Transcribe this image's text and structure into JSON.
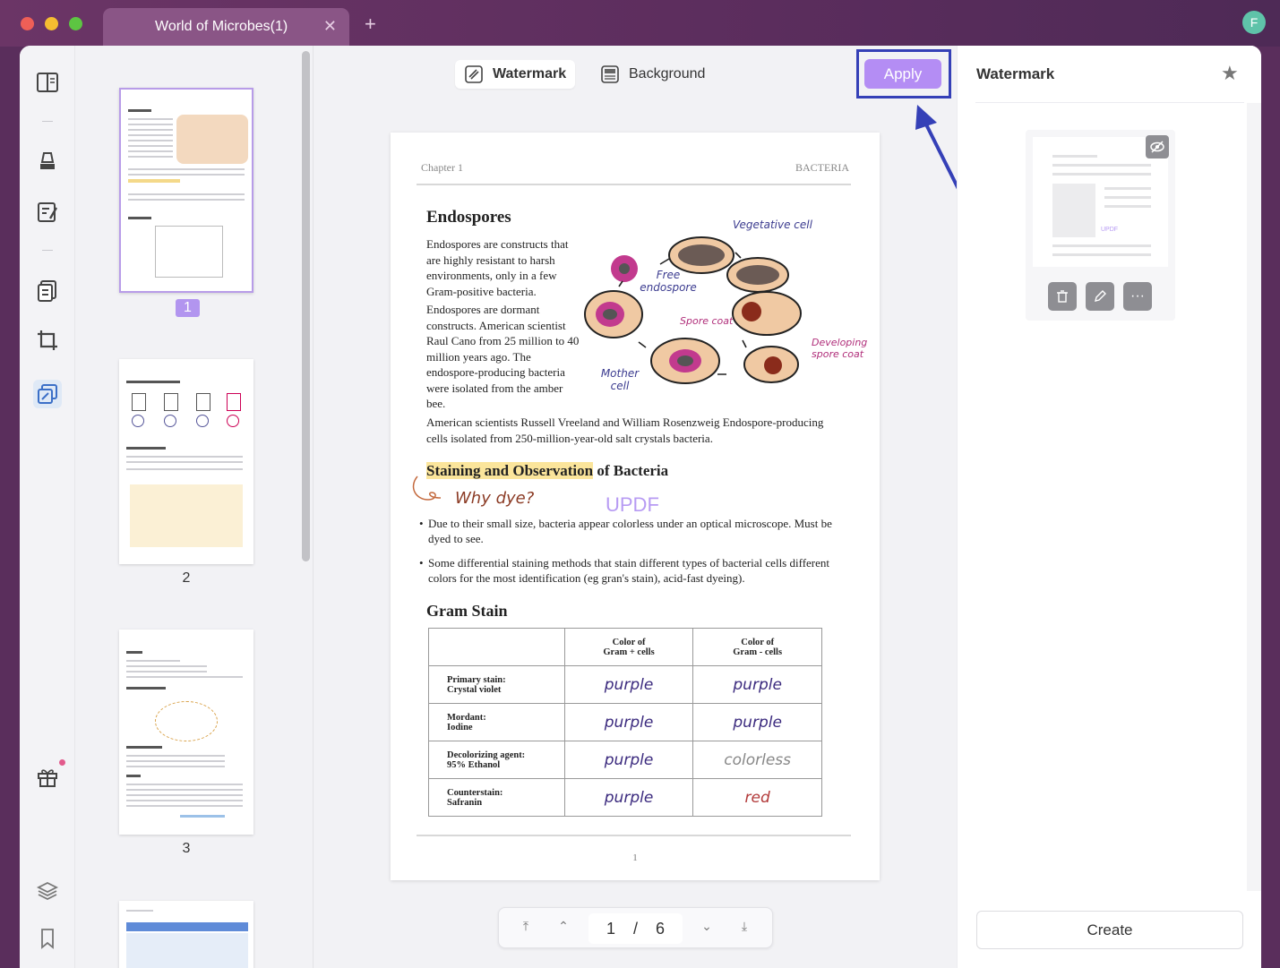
{
  "window": {
    "tab_title": "World of Microbes(1)",
    "tab_close": "✕",
    "tab_add": "+",
    "avatar_initial": "F"
  },
  "toolbar": {
    "watermark_label": "Watermark",
    "background_label": "Background",
    "apply_label": "Apply"
  },
  "thumbnails": [
    {
      "page": "1"
    },
    {
      "page": "2"
    },
    {
      "page": "3"
    }
  ],
  "document": {
    "chapter": "Chapter 1",
    "section": "BACTERIA",
    "heading_endospores": "Endospores",
    "para1": "Endospores are constructs that are highly resistant to harsh environments, only in a few Gram-positive bacteria.",
    "para2": "Endospores are dormant constructs. American scientist Raul Cano from 25 million to 40 million years ago. The endospore-producing bacteria were isolated from the amber bee.",
    "para3": "American scientists Russell Vreeland and William Rosenzweig Endospore-producing cells isolated from 250-million-year-old salt crystals bacteria.",
    "illustration_labels": {
      "vegetative": "Vegetative cell",
      "free": "Free endospore",
      "spore_coat": "Spore coat",
      "developing": "Developing spore coat",
      "mother": "Mother cell"
    },
    "heading_stain_highlight": "Staining and Observation",
    "heading_stain_rest": " of Bacteria",
    "why_dye": "Why dye?",
    "watermark_text": "UPDF",
    "bullet1": "Due to their small size, bacteria appear colorless under an optical microscope. Must be dyed to see.",
    "bullet2": "Some differential staining methods that stain different types of bacterial cells different colors for the most identification (eg gran's stain), acid-fast dyeing).",
    "heading_gram": "Gram Stain",
    "table": {
      "col1_line1": "Color of",
      "col1_line2": "Gram + cells",
      "col2_line1": "Color of",
      "col2_line2": "Gram - cells",
      "rows": [
        {
          "label1": "Primary stain:",
          "label2": "Crystal violet",
          "pos": "purple",
          "neg": "purple"
        },
        {
          "label1": "Mordant:",
          "label2": "Iodine",
          "pos": "purple",
          "neg": "purple"
        },
        {
          "label1": "Decolorizing agent:",
          "label2": "95% Ethanol",
          "pos": "purple",
          "neg": "colorless"
        },
        {
          "label1": "Counterstain:",
          "label2": "Safranin",
          "pos": "purple",
          "neg": "red"
        }
      ]
    },
    "page_number": "1"
  },
  "pager": {
    "current": "1",
    "separator": "/",
    "total": "6"
  },
  "right_panel": {
    "title": "Watermark",
    "card_text": "UPDF",
    "create_label": "Create"
  },
  "colors": {
    "accent": "#b48df4",
    "frame": "#3540b7",
    "titlebar": "#5b2d5d"
  }
}
